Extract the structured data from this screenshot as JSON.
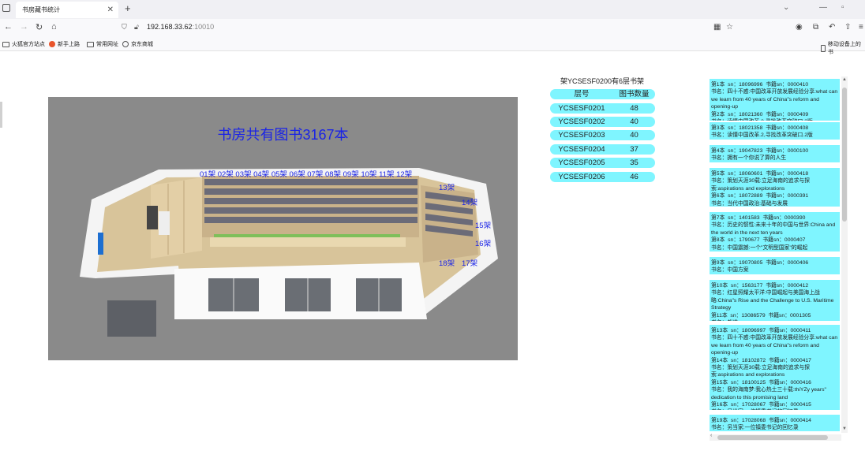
{
  "browser": {
    "tab_title": "书房藏书统计",
    "url_host": "192.168.33.62",
    "url_port": ":10010",
    "bookmarks": [
      "火狐官方站点",
      "新手上路",
      "常用网址",
      "京东商城"
    ],
    "mobile_bookmarks": "移动设备上的书"
  },
  "room": {
    "title": "书房共有图书3167本",
    "top_shelves": "01架 02架 03架 04架 05架 06架 07架 08架 09架 10架 11架 12架",
    "shelf_13": "13架",
    "shelf_14": "14架",
    "shelf_15": "15架",
    "shelf_16": "16架",
    "shelf_18": "18架",
    "shelf_17": "17架"
  },
  "shelf_table": {
    "title": "架YCSESF0200有6层书架",
    "header": {
      "col1": "层号",
      "col2": "图书数量"
    },
    "rows": [
      {
        "id": "YCSESF0201",
        "count": "48"
      },
      {
        "id": "YCSESF0202",
        "count": "40"
      },
      {
        "id": "YCSESF0203",
        "count": "40"
      },
      {
        "id": "YCSESF0204",
        "count": "37"
      },
      {
        "id": "YCSESF0205",
        "count": "35"
      },
      {
        "id": "YCSESF0206",
        "count": "46"
      }
    ]
  },
  "books": [
    "第1本  sn：18096996  书籍sn：0000410\n书名：四十不惑:中国改革开放发展经验分享:what can we learn from 40 years of China\"s reform and opening-up\n第2本  sn：18021360  书籍sn：0000409\n书名：读懂中国改革.2,寻找改革突破口.2版",
    "第3本  sn：18021358  书籍sn：0000408\n书名：读懂中国改革.2,寻找改革突破口.2版",
    "第4本  sn：19047823  书籍sn：0000100\n书名：拥有一个你说了算的人生",
    "第5本  sn：18060601  书籍sn：0000418\n书名：策划天涯30载:立足海南的追求与探索:aspirations and explorations\n第6本  sn：18072889  书籍sn：0000391\n书名：当代中国政治:基础与发展",
    "第7本  sn：1401583  书籍sn：0000390\n书名：历史的惯性:未来十年的中国与世界:China and the world in the next ten years\n第8本  sn：1790677  书籍sn：0000407\n书名：中国震撼:一个\"文明型国家\"的崛起",
    "第9本  sn：19070805  书籍sn：0000406\n书名：中国方案",
    "第10本  sn：1563177  书籍sn：0000412\n书名：红星照耀太平洋:中国崛起与美国海上战略:China\"s Rise and the Challenge to U.S. Maritime Strategy\n第11本  sn：13086579  书籍sn：0001305\n书名：裁道",
    "第13本  sn：18096997  书籍sn：0000411\n书名：四十不惑:中国改革开放发展经验分享:what can we learn from 40 years of China\"s reform and opening-up\n第14本  sn：18102872  书籍sn：0000417\n书名：策划天涯30载:立足海南的追求与探索:aspirations and explorations\n第15本  sn：18100125  书籍sn：0000416\n书名：我的海南梦:我心热土三十载:thiYZy years\" dedication to this promising land\n第16本  sn：17028067  书籍sn：0000415\n书名：另当家:一位镇委书记的回忆录",
    "第19本  sn：17028068  书籍sn：0000414\n书名：另当家:一位镇委书记的回忆录"
  ]
}
